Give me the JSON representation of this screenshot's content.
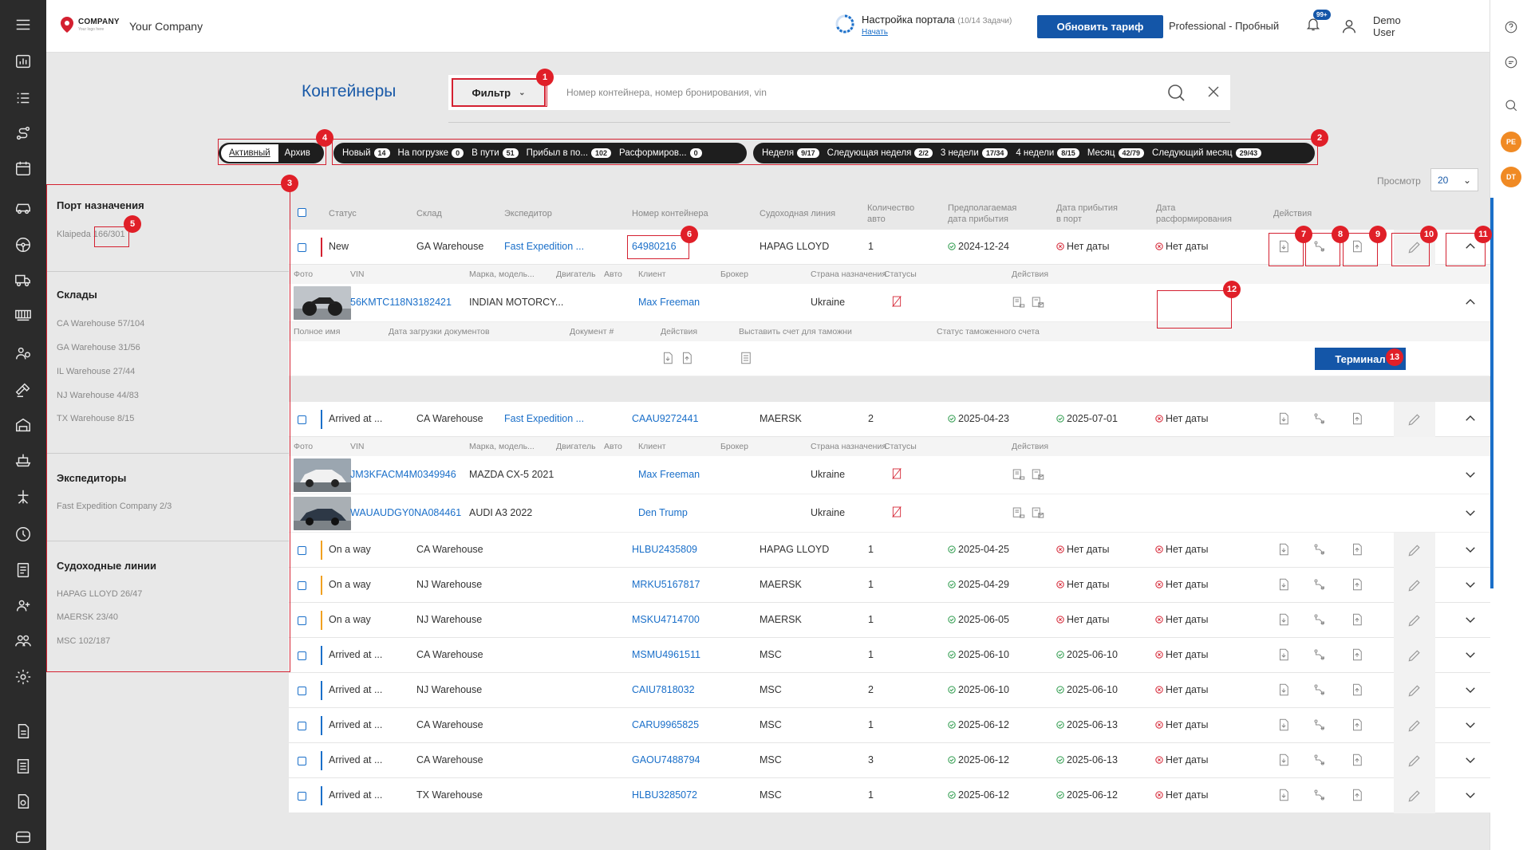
{
  "header": {
    "logo_text": "COMPANY",
    "logo_sub": "Your logo here",
    "company_name": "Your Company",
    "portal_title": "Настройка портала",
    "portal_progress": "(10/14 Задачи)",
    "portal_start": "Начать",
    "upgrade_label": "Обновить тариф",
    "plan": "Professional - Пробный",
    "notif_badge": "99+",
    "user_first": "Demo",
    "user_last": "User"
  },
  "page": {
    "title": "Контейнеры",
    "filter_label": "Фильтр",
    "search_placeholder": "Номер контейнера, номер бронирования, vin",
    "browse_label": "Просмотр",
    "per_page": "20"
  },
  "toggle": {
    "active": "Активный",
    "archive": "Архив"
  },
  "status_pills": [
    {
      "label": "Новый",
      "count": "14"
    },
    {
      "label": "На погрузке",
      "count": "0"
    },
    {
      "label": "В пути",
      "count": "51"
    },
    {
      "label": "Прибыл в по...",
      "count": "102"
    },
    {
      "label": "Расформиров...",
      "count": "0"
    }
  ],
  "period_pills": [
    {
      "label": "Неделя",
      "count": "9/17"
    },
    {
      "label": "Следующая неделя",
      "count": "2/2"
    },
    {
      "label": "3 недели",
      "count": "17/34"
    },
    {
      "label": "4 недели",
      "count": "8/15"
    },
    {
      "label": "Месяц",
      "count": "42/79"
    },
    {
      "label": "Следующий месяц",
      "count": "29/43"
    }
  ],
  "annotations": [
    "1",
    "2",
    "3",
    "4",
    "5",
    "6",
    "7",
    "8",
    "9",
    "10",
    "11",
    "12",
    "13"
  ],
  "filters": {
    "port_title": "Порт назначения",
    "port_name": "Klaipeda",
    "port_count": "166/301",
    "warehouses_title": "Склады",
    "warehouses": [
      "CA Warehouse 57/104",
      "GA Warehouse 31/56",
      "IL Warehouse 27/44",
      "NJ Warehouse 44/83",
      "TX Warehouse 8/15"
    ],
    "forwarders_title": "Экспедиторы",
    "forwarders": [
      "Fast Expedition Company 2/3"
    ],
    "lines_title": "Судоходные линии",
    "lines": [
      "HAPAG LLOYD 26/47",
      "MAERSK 23/40",
      "MSC 102/187"
    ]
  },
  "table": {
    "columns": {
      "status": "Статус",
      "warehouse": "Склад",
      "forwarder": "Экспедитор",
      "container": "Номер контейнера",
      "line": "Судоходная линия",
      "qty": [
        "Количество",
        "авто"
      ],
      "eta": [
        "Предполагаемая",
        "дата прибытия"
      ],
      "arrival": [
        "Дата прибытия",
        "в порт"
      ],
      "unload": [
        "Дата",
        "расформирования"
      ],
      "actions": "Действия"
    },
    "sub_columns": {
      "photo": "Фото",
      "vin": "VIN",
      "make": "Марка, модель...",
      "engine": "Двигатель",
      "auto": "Авто",
      "client": "Клиент",
      "broker": "Брокер",
      "country": "Страна назначения",
      "statuses": "Статусы",
      "actions": "Действия"
    },
    "doc_columns": {
      "fullname": "Полное имя",
      "doc_date": "Дата загрузки документов",
      "doc_no": "Документ #",
      "actions": "Действия",
      "invoice": "Выставить счет для таможни",
      "invoice_status": "Статус таможенного счета"
    },
    "terminal_label": "Терминал",
    "rows": [
      {
        "status": "New",
        "warehouse": "GA Warehouse",
        "forwarder": "Fast Expedition ...",
        "container": "64980216",
        "line": "HAPAG LLOYD",
        "qty": "1",
        "eta": "2024-12-24",
        "arrival": "Нет даты",
        "unload": "Нет даты",
        "color": "#d42030"
      },
      {
        "status": "Arrived at ...",
        "warehouse": "CA Warehouse",
        "forwarder": "Fast Expedition ...",
        "container": "CAAU9272441",
        "line": "MAERSK",
        "qty": "2",
        "eta": "2025-04-23",
        "arrival": "2025-07-01",
        "unload": "Нет даты",
        "color": "#1a6fc9"
      },
      {
        "status": "On a way",
        "warehouse": "CA Warehouse",
        "forwarder": "",
        "container": "HLBU2435809",
        "line": "HAPAG LLOYD",
        "qty": "1",
        "eta": "2025-04-25",
        "arrival": "Нет даты",
        "unload": "Нет даты",
        "color": "#f0a020"
      },
      {
        "status": "On a way",
        "warehouse": "NJ Warehouse",
        "forwarder": "",
        "container": "MRKU5167817",
        "line": "MAERSK",
        "qty": "1",
        "eta": "2025-04-29",
        "arrival": "Нет даты",
        "unload": "Нет даты",
        "color": "#f0a020"
      },
      {
        "status": "On a way",
        "warehouse": "NJ Warehouse",
        "forwarder": "",
        "container": "MSKU4714700",
        "line": "MAERSK",
        "qty": "1",
        "eta": "2025-06-05",
        "arrival": "Нет даты",
        "unload": "Нет даты",
        "color": "#f0a020"
      },
      {
        "status": "Arrived at ...",
        "warehouse": "CA Warehouse",
        "forwarder": "",
        "container": "MSMU4961511",
        "line": "MSC",
        "qty": "1",
        "eta": "2025-06-10",
        "arrival": "2025-06-10",
        "unload": "Нет даты",
        "color": "#1a6fc9"
      },
      {
        "status": "Arrived at ...",
        "warehouse": "NJ Warehouse",
        "forwarder": "",
        "container": "CAIU7818032",
        "line": "MSC",
        "qty": "2",
        "eta": "2025-06-10",
        "arrival": "2025-06-10",
        "unload": "Нет даты",
        "color": "#1a6fc9"
      },
      {
        "status": "Arrived at ...",
        "warehouse": "CA Warehouse",
        "forwarder": "",
        "container": "CARU9965825",
        "line": "MSC",
        "qty": "1",
        "eta": "2025-06-12",
        "arrival": "2025-06-13",
        "unload": "Нет даты",
        "color": "#1a6fc9"
      },
      {
        "status": "Arrived at ...",
        "warehouse": "CA Warehouse",
        "forwarder": "",
        "container": "GAOU7488794",
        "line": "MSC",
        "qty": "3",
        "eta": "2025-06-12",
        "arrival": "2025-06-13",
        "unload": "Нет даты",
        "color": "#1a6fc9"
      },
      {
        "status": "Arrived at ...",
        "warehouse": "TX Warehouse",
        "forwarder": "",
        "container": "HLBU3285072",
        "line": "MSC",
        "qty": "1",
        "eta": "2025-06-12",
        "arrival": "2025-06-12",
        "unload": "Нет даты",
        "color": "#1a6fc9"
      }
    ],
    "vehicles": [
      {
        "vin": "56KMTC118N3182421",
        "make": "INDIAN MOTORCY...",
        "client": "Max Freeman",
        "country": "Ukraine"
      },
      {
        "vin": "JM3KFACM4M0349946",
        "make": "MAZDA CX-5 2021",
        "client": "Max Freeman",
        "country": "Ukraine"
      },
      {
        "vin": "WAUAUDGY0NA084461",
        "make": "AUDI A3 2022",
        "client": "Den Trump",
        "country": "Ukraine"
      }
    ]
  },
  "right_avatars": [
    "PE",
    "DT"
  ]
}
